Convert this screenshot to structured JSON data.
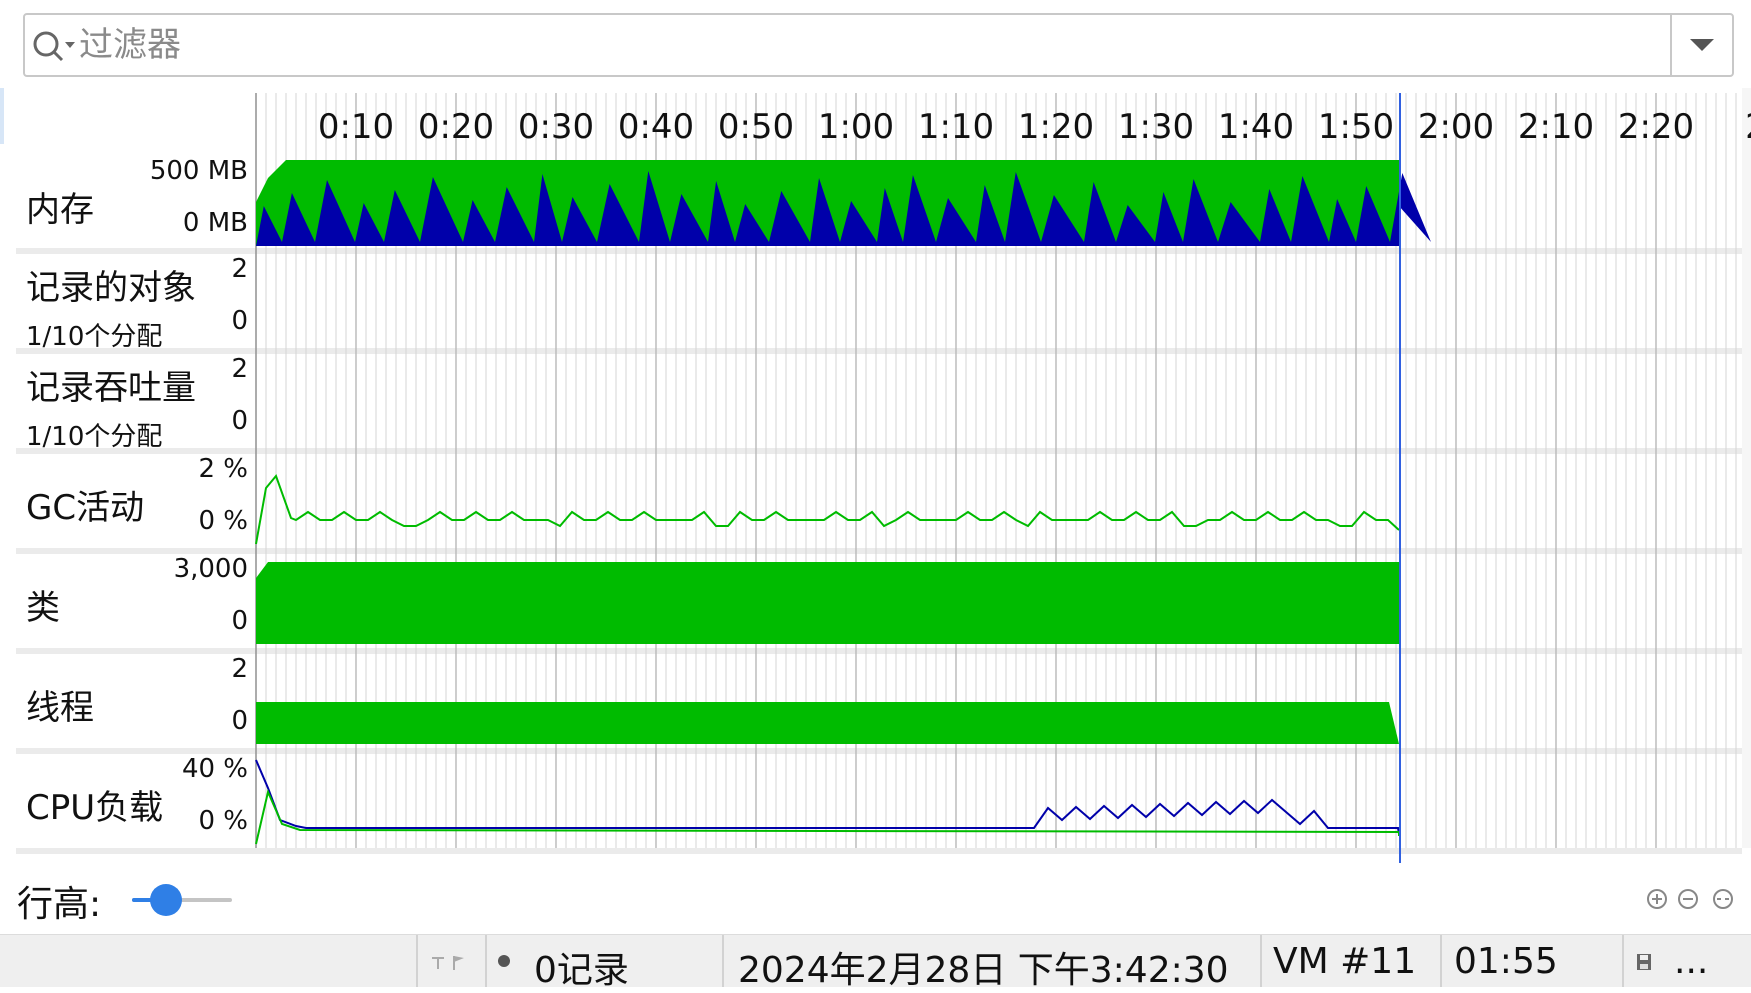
{
  "filter": {
    "placeholder": "过滤器",
    "value": ""
  },
  "icons": {
    "search": "search-icon",
    "dropdown": "chevron-down-icon",
    "pin": "pin-icon",
    "flag": "flag-icon",
    "dot": "record-dot-icon",
    "save": "save-icon",
    "zoom_in": "zoom-in-icon",
    "zoom_out": "zoom-out-icon",
    "zoom_fit": "zoom-fit-icon"
  },
  "time_axis": {
    "ticks": [
      "0:10",
      "0:20",
      "0:30",
      "0:40",
      "0:50",
      "1:00",
      "1:10",
      "1:20",
      "1:30",
      "1:40",
      "1:50",
      "2:00",
      "2:10",
      "2:20",
      "2"
    ],
    "current_time": "01:55"
  },
  "rows": [
    {
      "id": "memory",
      "title": "内存",
      "subtitle": "",
      "max_label": "500 MB",
      "min_label": "0 MB"
    },
    {
      "id": "recorded-objects",
      "title": "记录的对象",
      "subtitle": "1/10个分配",
      "max_label": "2",
      "min_label": "0"
    },
    {
      "id": "recorded-throughput",
      "title": "记录吞吐量",
      "subtitle": "1/10个分配",
      "max_label": "2",
      "min_label": "0"
    },
    {
      "id": "gc-activity",
      "title": "GC活动",
      "subtitle": "",
      "max_label": "2 %",
      "min_label": "0 %"
    },
    {
      "id": "classes",
      "title": "类",
      "subtitle": "",
      "max_label": "3,000",
      "min_label": "0"
    },
    {
      "id": "threads",
      "title": "线程",
      "subtitle": "",
      "max_label": "2",
      "min_label": "0"
    },
    {
      "id": "cpu-load",
      "title": "CPU负载",
      "subtitle": "",
      "max_label": "40 %",
      "min_label": "0 %"
    }
  ],
  "row_height": {
    "label": "行高:",
    "value": 0.35
  },
  "status": {
    "records": "0记录",
    "datetime": "2024年2月28日 下午3:42:30",
    "vm": "VM #11",
    "elapsed": "01:55",
    "more": "..."
  },
  "colors": {
    "green": "#00bb00",
    "blue": "#0000aa",
    "grid": "#c8c8c8",
    "cursor": "#3060e0",
    "band": "#ebebeb"
  }
}
